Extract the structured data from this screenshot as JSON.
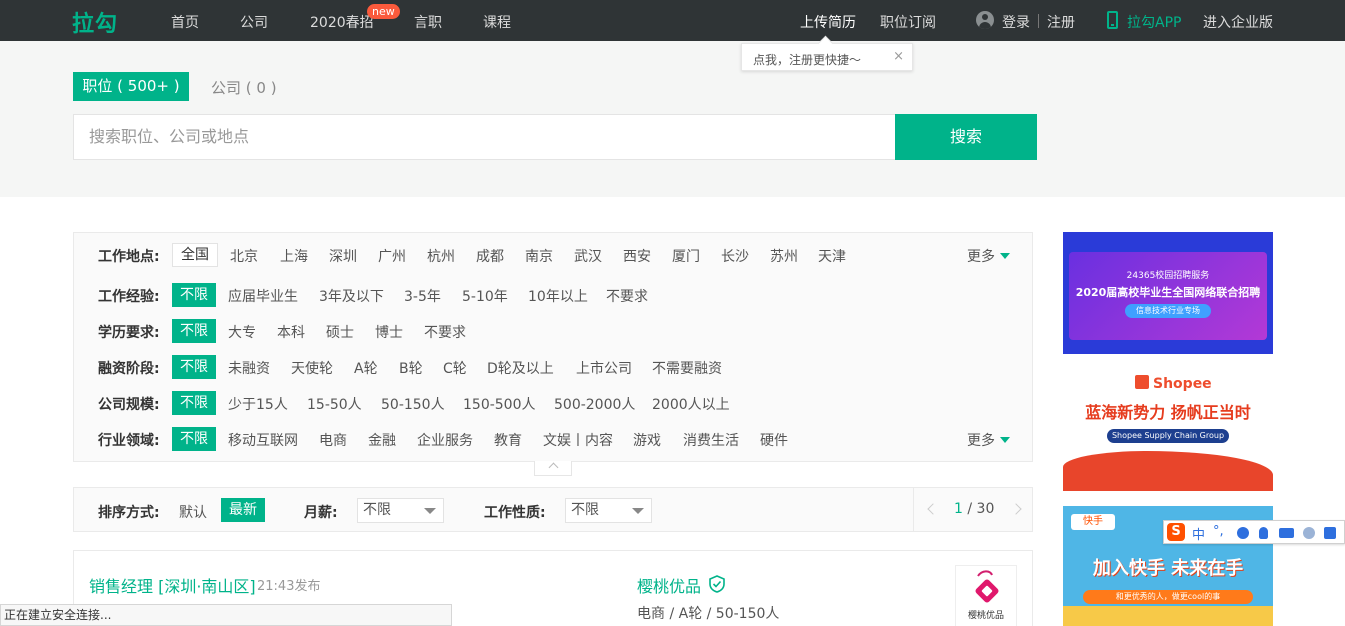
{
  "topnav": {
    "logo": "拉勾",
    "items": [
      "首页",
      "公司",
      "2020春招",
      "言职",
      "课程"
    ],
    "badge": "new",
    "right": {
      "upload_resume": "上传简历",
      "job_subscribe": "职位订阅",
      "login": "登录",
      "register": "注册",
      "app": "拉勾APP",
      "enterprise": "进入企业版"
    }
  },
  "tooltip": {
    "text": "点我，注册更快捷～",
    "close": "×"
  },
  "search": {
    "tab_jobs": "职位 ( 500+ )",
    "tab_company": "公司 ( 0 )",
    "placeholder": "搜索职位、公司或地点",
    "button": "搜索"
  },
  "filters": {
    "location": {
      "label": "工作地点:",
      "selected": "全国",
      "options": [
        "北京",
        "上海",
        "深圳",
        "广州",
        "杭州",
        "成都",
        "南京",
        "武汉",
        "西安",
        "厦门",
        "长沙",
        "苏州",
        "天津"
      ],
      "more": "更多"
    },
    "experience": {
      "label": "工作经验:",
      "selected": "不限",
      "options": [
        "应届毕业生",
        "3年及以下",
        "3-5年",
        "5-10年",
        "10年以上",
        "不要求"
      ]
    },
    "education": {
      "label": "学历要求:",
      "selected": "不限",
      "options": [
        "大专",
        "本科",
        "硕士",
        "博士",
        "不要求"
      ]
    },
    "funding": {
      "label": "融资阶段:",
      "selected": "不限",
      "options": [
        "未融资",
        "天使轮",
        "A轮",
        "B轮",
        "C轮",
        "D轮及以上",
        "上市公司",
        "不需要融资"
      ]
    },
    "size": {
      "label": "公司规模:",
      "selected": "不限",
      "options": [
        "少于15人",
        "15-50人",
        "50-150人",
        "150-500人",
        "500-2000人",
        "2000人以上"
      ]
    },
    "industry": {
      "label": "行业领域:",
      "selected": "不限",
      "options": [
        "移动互联网",
        "电商",
        "金融",
        "企业服务",
        "教育",
        "文娱丨内容",
        "游戏",
        "消费生活",
        "硬件"
      ],
      "more": "更多"
    }
  },
  "sort": {
    "label": "排序方式:",
    "default": "默认",
    "latest": "最新",
    "salary_label": "月薪:",
    "salary_value": "不限",
    "nature_label": "工作性质:",
    "nature_value": "不限",
    "pager": {
      "current": "1",
      "sep": " / ",
      "total": "30"
    }
  },
  "job": {
    "title": "销售经理 [深圳·南山区]",
    "time": "21:43发布",
    "company": "樱桃优品",
    "meta": "电商 / A轮 / 50-150人",
    "logo_text": "樱桃优品"
  },
  "status_bar": "正在建立安全连接...",
  "ads": {
    "ad1": {
      "line1": "24365校园招聘服务",
      "line2": "2020届高校毕业生全国网络联合招聘",
      "line3": "信息技术行业专场"
    },
    "ad2": {
      "brand": "Shopee",
      "slogan": "蓝海新势力 扬帆正当时",
      "tag": "Shopee Supply Chain Group"
    },
    "ad3": {
      "brand": "快手",
      "slogan": "加入快手 未来在手",
      "sub": "和更优秀的人，做更cool的事"
    }
  },
  "ime": {
    "logo": "S",
    "lang": "中",
    "punct": "°,"
  },
  "colors": {
    "brand": "#00b38a",
    "nav_bg": "#2f3436",
    "badge": "#fa5a3c"
  }
}
